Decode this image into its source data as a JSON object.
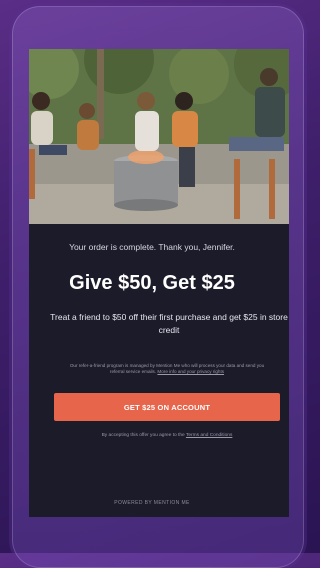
{
  "confirmation": {
    "order_message": "Your order is complete. Thank you, Jennifer."
  },
  "offer": {
    "headline": "Give $50, Get $25",
    "description": "Treat a friend to $50 off their first purchase and get $25 in store credit",
    "fineprint": "Our refer-a-friend program is managed by Mention Me who will process your data and send you referral service emails.",
    "fineprint_link": "More info and your privacy rights",
    "cta_label": "GET $25 ON ACCOUNT",
    "terms_prefix": "By accepting this offer you agree to the",
    "terms_link": "Terms and Conditions"
  },
  "footer": {
    "powered_by": "POWERED BY MENTION ME"
  },
  "colors": {
    "accent": "#e7654a",
    "screen_bg": "#1c1b2a",
    "page_bg": "#3f1f6b"
  }
}
